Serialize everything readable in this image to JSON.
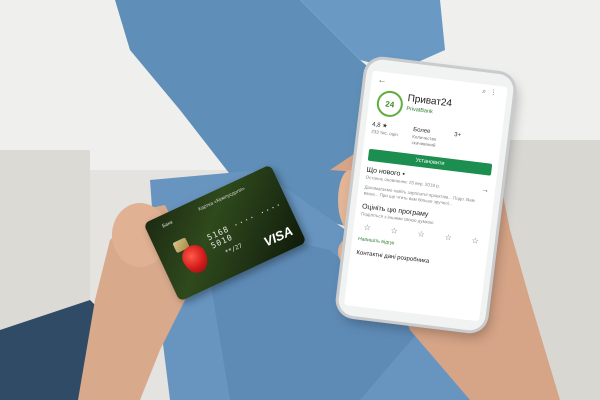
{
  "phone": {
    "app_name": "Приват24",
    "developer": "PrivatBank",
    "logo_text": "24",
    "rating": "4,8 ★",
    "reviews_count": "233 тис. оцін.",
    "downloads": "Более",
    "downloads_label": "Количество скачиваний",
    "age": "3+",
    "install_label": "Установити",
    "whats_new_title": "Що нового •",
    "whats_new_sub": "Останнє оновлення: 23 вер. 2019 р.",
    "whats_new_note": "Допомагаємо навіть зарплатні проектам... Подп. Вам ваша... При ще чтить вам більше зручної...",
    "rate_title": "Оцініть цю програму",
    "rate_sub": "Поділіться з іншими своєю думкою",
    "review_link": "Напишіть відгук",
    "contact_title": "Контактні дані розробника"
  },
  "card": {
    "bank_label": "Банк",
    "holder_label": "Картка «Кемпусдоля»",
    "number": "5168 ···· ···· 5010",
    "expiry": "**/27",
    "brand": "VISA"
  },
  "colors": {
    "accent_green": "#1c8e4f",
    "logo_green": "#5fae3c",
    "card_dark": "#1d2a12"
  }
}
